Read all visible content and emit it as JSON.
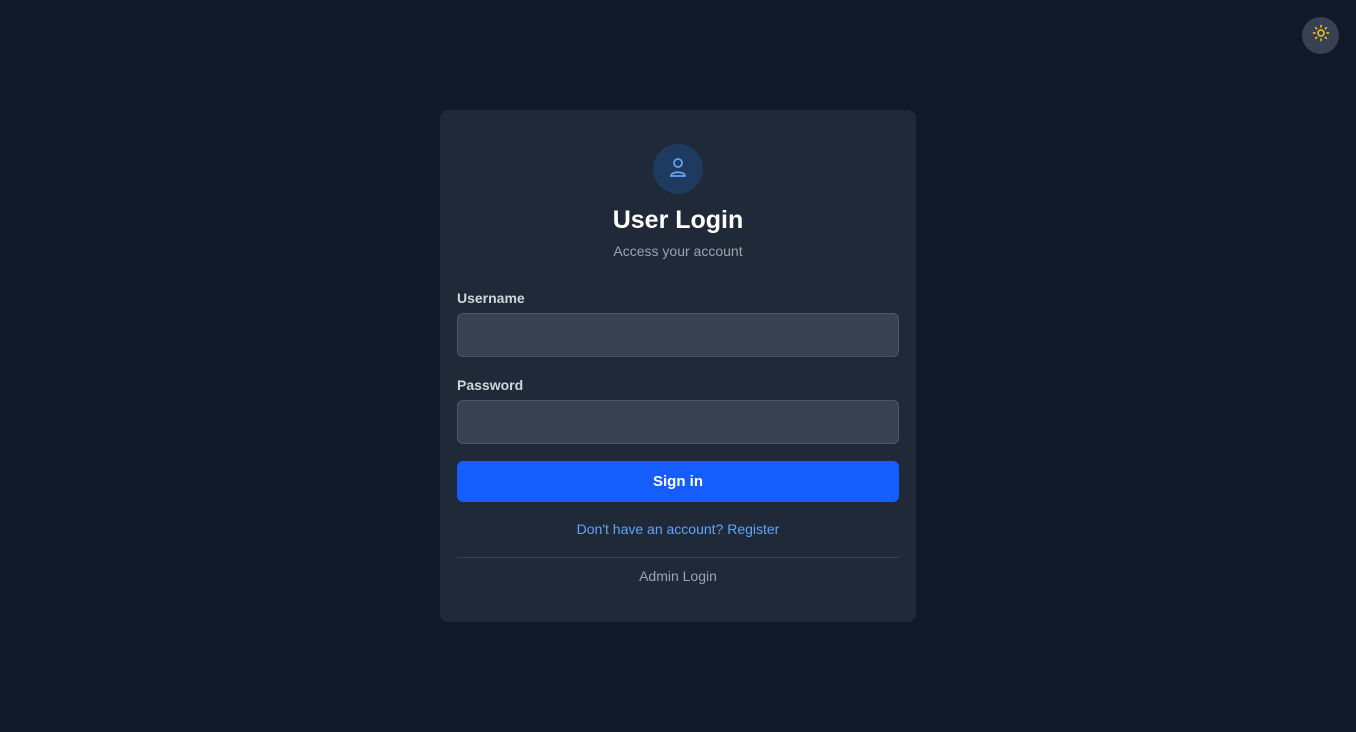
{
  "theme_toggle": {
    "icon": "sun-icon",
    "icon_color": "#facc15"
  },
  "login": {
    "avatar_icon": "user-icon",
    "title": "User Login",
    "subtitle": "Access your account",
    "username_label": "Username",
    "username_value": "",
    "password_label": "Password",
    "password_value": "",
    "signin_label": "Sign in",
    "register_link": "Don't have an account? Register",
    "admin_link": "Admin Login"
  },
  "colors": {
    "background": "#111827",
    "card": "#1f2937",
    "input": "#374151",
    "primary": "#155dfc",
    "link": "#60a5fa",
    "muted": "#9ca3af"
  }
}
